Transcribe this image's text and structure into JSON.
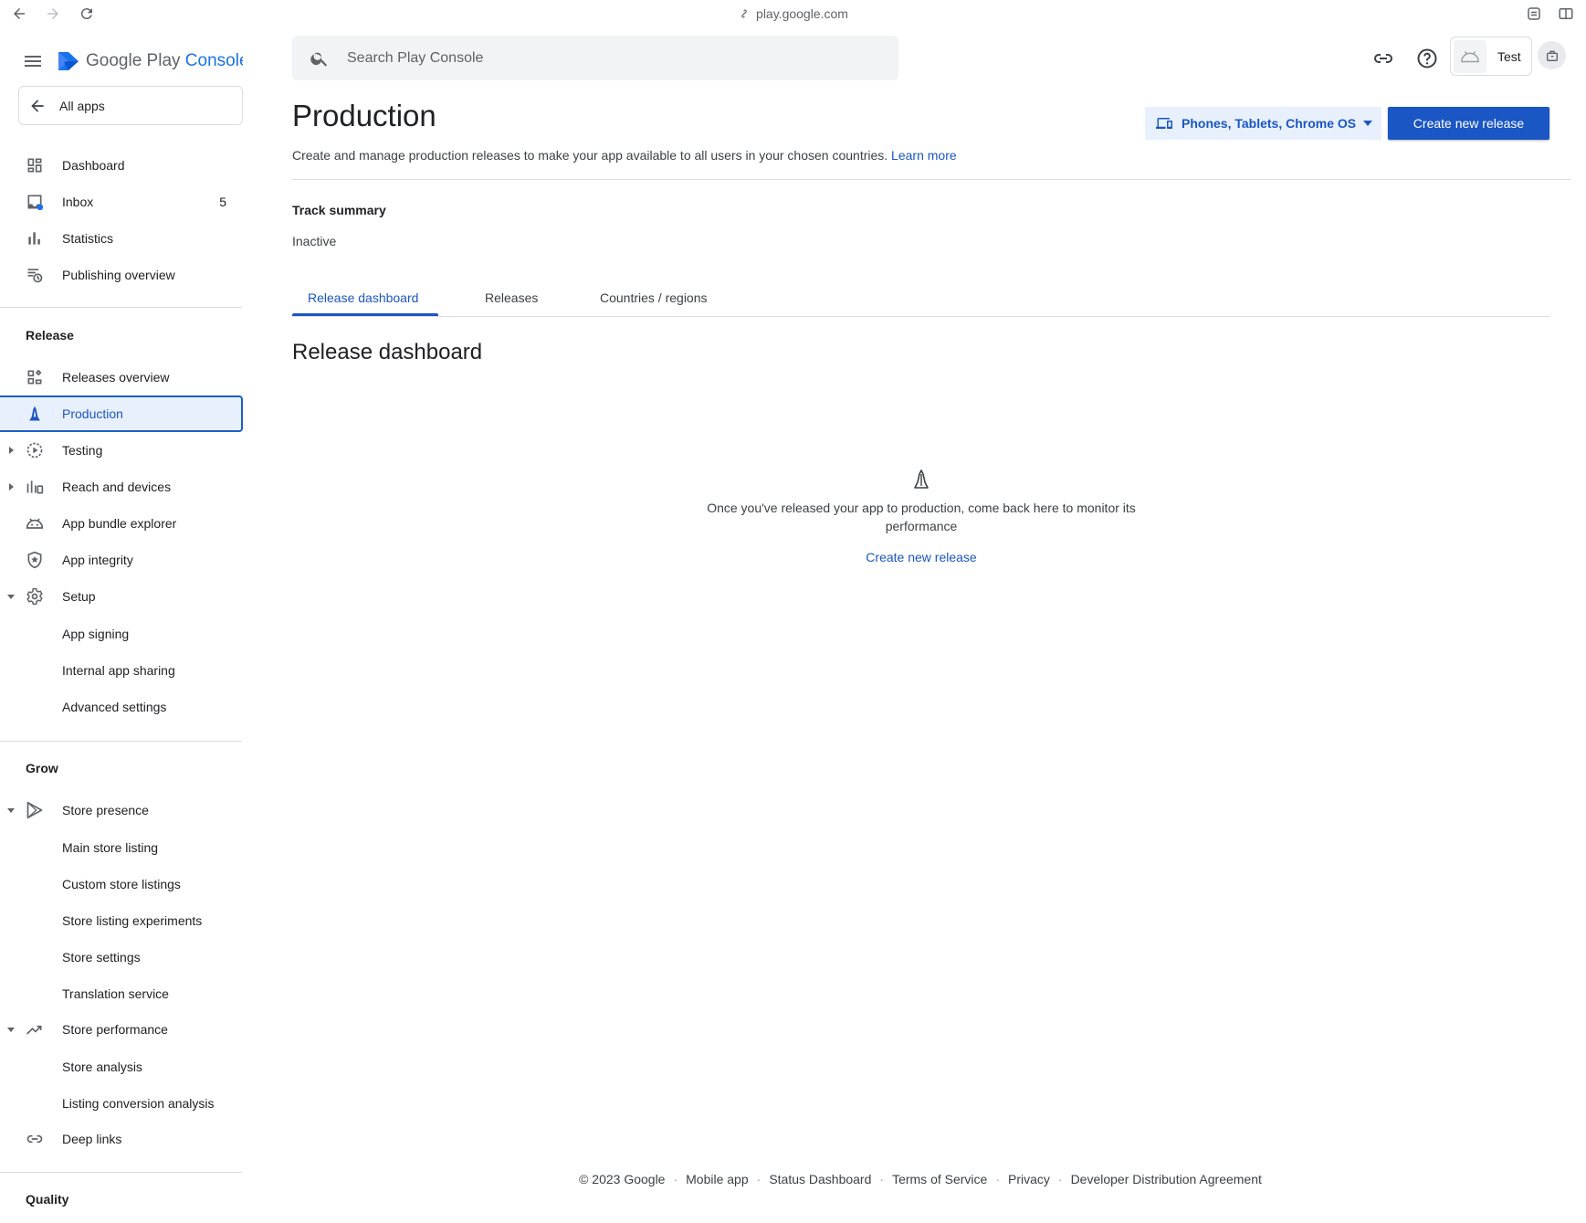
{
  "browser": {
    "url": "play.google.com"
  },
  "brand": {
    "part1": "Google Play",
    "part2": "Console"
  },
  "sidebar": {
    "all_apps": "All apps",
    "top_items": [
      {
        "label": "Dashboard",
        "icon": "dashboard-icon"
      },
      {
        "label": "Inbox",
        "icon": "inbox-icon",
        "badge": "5"
      },
      {
        "label": "Statistics",
        "icon": "bar-chart-icon"
      },
      {
        "label": "Publishing overview",
        "icon": "publishing-icon"
      }
    ],
    "release_section": "Release",
    "release_items": [
      {
        "label": "Releases overview",
        "icon": "releases-overview-icon"
      },
      {
        "label": "Production",
        "icon": "production-icon",
        "active": true
      },
      {
        "label": "Testing",
        "icon": "testing-icon"
      },
      {
        "label": "Reach and devices",
        "icon": "reach-devices-icon"
      },
      {
        "label": "App bundle explorer",
        "icon": "android-icon"
      },
      {
        "label": "App integrity",
        "icon": "shield-icon"
      },
      {
        "label": "Setup",
        "icon": "gear-icon"
      }
    ],
    "setup_sub": [
      "App signing",
      "Internal app sharing",
      "Advanced settings"
    ],
    "grow_section": "Grow",
    "store_presence": "Store presence",
    "store_presence_sub": [
      "Main store listing",
      "Custom store listings",
      "Store listing experiments",
      "Store settings",
      "Translation service"
    ],
    "store_performance": "Store performance",
    "store_performance_sub": [
      "Store analysis",
      "Listing conversion analysis"
    ],
    "deep_links": "Deep links",
    "quality_section": "Quality"
  },
  "header": {
    "search_placeholder": "Search Play Console",
    "profile_name": "Test"
  },
  "main": {
    "title": "Production",
    "device_selector": "Phones, Tablets, Chrome OS",
    "create_button": "Create new release",
    "description": "Create and manage production releases to make your app available to all users in your chosen countries.",
    "learn_more": "Learn more",
    "track_summary_title": "Track summary",
    "track_status": "Inactive",
    "tabs": [
      "Release dashboard",
      "Releases",
      "Countries / regions"
    ],
    "section_title": "Release dashboard",
    "empty_text": "Once you've released your app to production, come back here to monitor its performance",
    "empty_link": "Create new release"
  },
  "footer": [
    "© 2023 Google",
    "Mobile app",
    "Status Dashboard",
    "Terms of Service",
    "Privacy",
    "Developer Distribution Agreement"
  ],
  "colors": {
    "accent": "#1a56c4",
    "active_bg": "#e8f0fe",
    "divider": "#dadce0"
  }
}
